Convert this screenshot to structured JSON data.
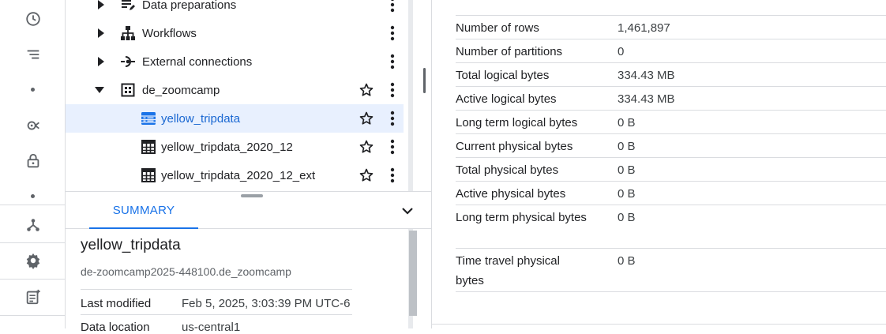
{
  "explorer": {
    "tree": [
      {
        "label": "Data preparations",
        "icon": "data-preparation-icon",
        "expandable": true
      },
      {
        "label": "Workflows",
        "icon": "workflow-icon",
        "expandable": true
      },
      {
        "label": "External connections",
        "icon": "external-connection-icon",
        "expandable": true
      },
      {
        "label": "de_zoomcamp",
        "icon": "dataset-icon",
        "expanded": true
      },
      {
        "label": "yellow_tripdata",
        "icon": "table-icon",
        "selected": true
      },
      {
        "label": "yellow_tripdata_2020_12",
        "icon": "table-icon"
      },
      {
        "label": "yellow_tripdata_2020_12_ext",
        "icon": "table-icon"
      }
    ]
  },
  "summary": {
    "tab_label": "SUMMARY",
    "title": "yellow_tripdata",
    "path": "de-zoomcamp2025-448100.de_zoomcamp",
    "rows": [
      {
        "key": "Last modified",
        "value": "Feb 5, 2025, 3:03:39 PM UTC-6"
      },
      {
        "key": "Data location",
        "value": "us-central1"
      }
    ]
  },
  "storage": {
    "rows": [
      {
        "key": "Number of rows",
        "value": "1,461,897"
      },
      {
        "key": "Number of partitions",
        "value": "0"
      },
      {
        "key": "Total logical bytes",
        "value": "334.43 MB"
      },
      {
        "key": "Active logical bytes",
        "value": "334.43 MB"
      },
      {
        "key": "Long term logical bytes",
        "value": "0 B"
      },
      {
        "key": "Current physical bytes",
        "value": "0 B"
      },
      {
        "key": "Total physical bytes",
        "value": "0 B"
      },
      {
        "key": "Active physical bytes",
        "value": "0 B"
      },
      {
        "key": "Long term physical bytes",
        "value": "0 B"
      },
      {
        "key": "Time travel physical bytes",
        "value": "0 B"
      }
    ]
  },
  "colors": {
    "accent": "#1a73e8",
    "selected_bg": "#e8f0fe",
    "divider": "#dadce0",
    "icon_gray": "#5f6368"
  }
}
